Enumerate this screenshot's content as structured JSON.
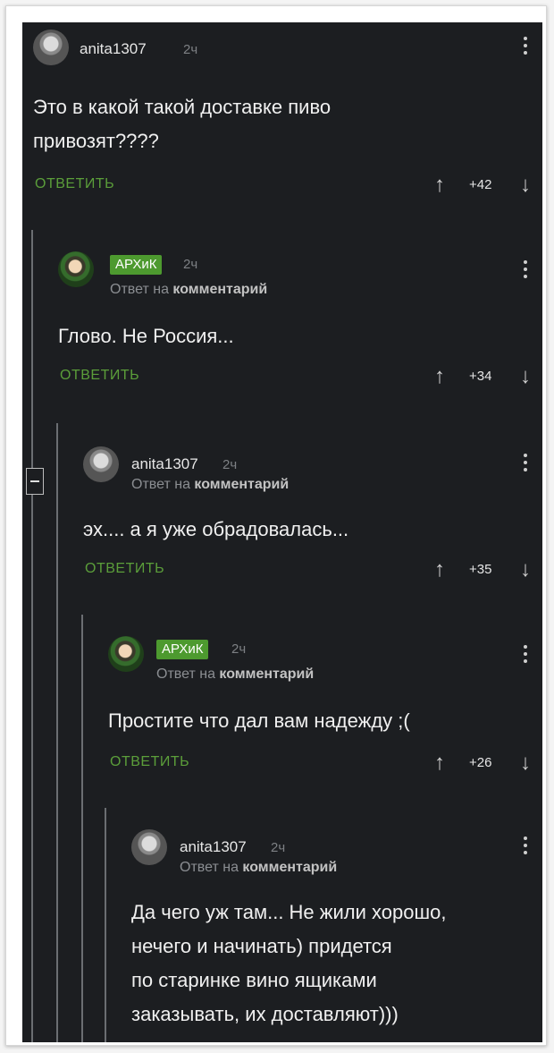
{
  "comments": [
    {
      "username": "anita1307",
      "time": "2ч",
      "text_lines": [
        "Это в какой такой доставке пиво",
        "привозят????"
      ],
      "reply_label": "ОТВЕТИТЬ",
      "score": "+42"
    },
    {
      "username": "АРХиК",
      "time": "2ч",
      "reply_to_prefix": "Ответ на",
      "reply_to_target": "комментарий",
      "text_lines": [
        "Глово. Не Россия..."
      ],
      "reply_label": "ОТВЕТИТЬ",
      "score": "+34"
    },
    {
      "username": "anita1307",
      "time": "2ч",
      "reply_to_prefix": "Ответ на",
      "reply_to_target": "комментарий",
      "text_lines": [
        "эх.... а я уже обрадовалась..."
      ],
      "reply_label": "ОТВЕТИТЬ",
      "score": "+35"
    },
    {
      "username": "АРХиК",
      "time": "2ч",
      "reply_to_prefix": "Ответ на",
      "reply_to_target": "комментарий",
      "text_lines": [
        "Простите что дал вам надежду ;("
      ],
      "reply_label": "ОТВЕТИТЬ",
      "score": "+26"
    },
    {
      "username": "anita1307",
      "time": "2ч",
      "reply_to_prefix": "Ответ на",
      "reply_to_target": "комментарий",
      "text_lines": [
        "Да чего уж там... Не жили хорошо,",
        "нечего и начинать) придется",
        "по старинке вино ящиками",
        "заказывать, их доставляют)))"
      ]
    }
  ],
  "icons": {
    "up": "arrow-up-icon",
    "down": "arrow-down-icon",
    "more": "more-vertical-icon",
    "collapse": "collapse-icon"
  },
  "colors": {
    "background": "#1c1e21",
    "accent_green": "#5b9e3a",
    "badge_green": "#4d9a2f"
  }
}
